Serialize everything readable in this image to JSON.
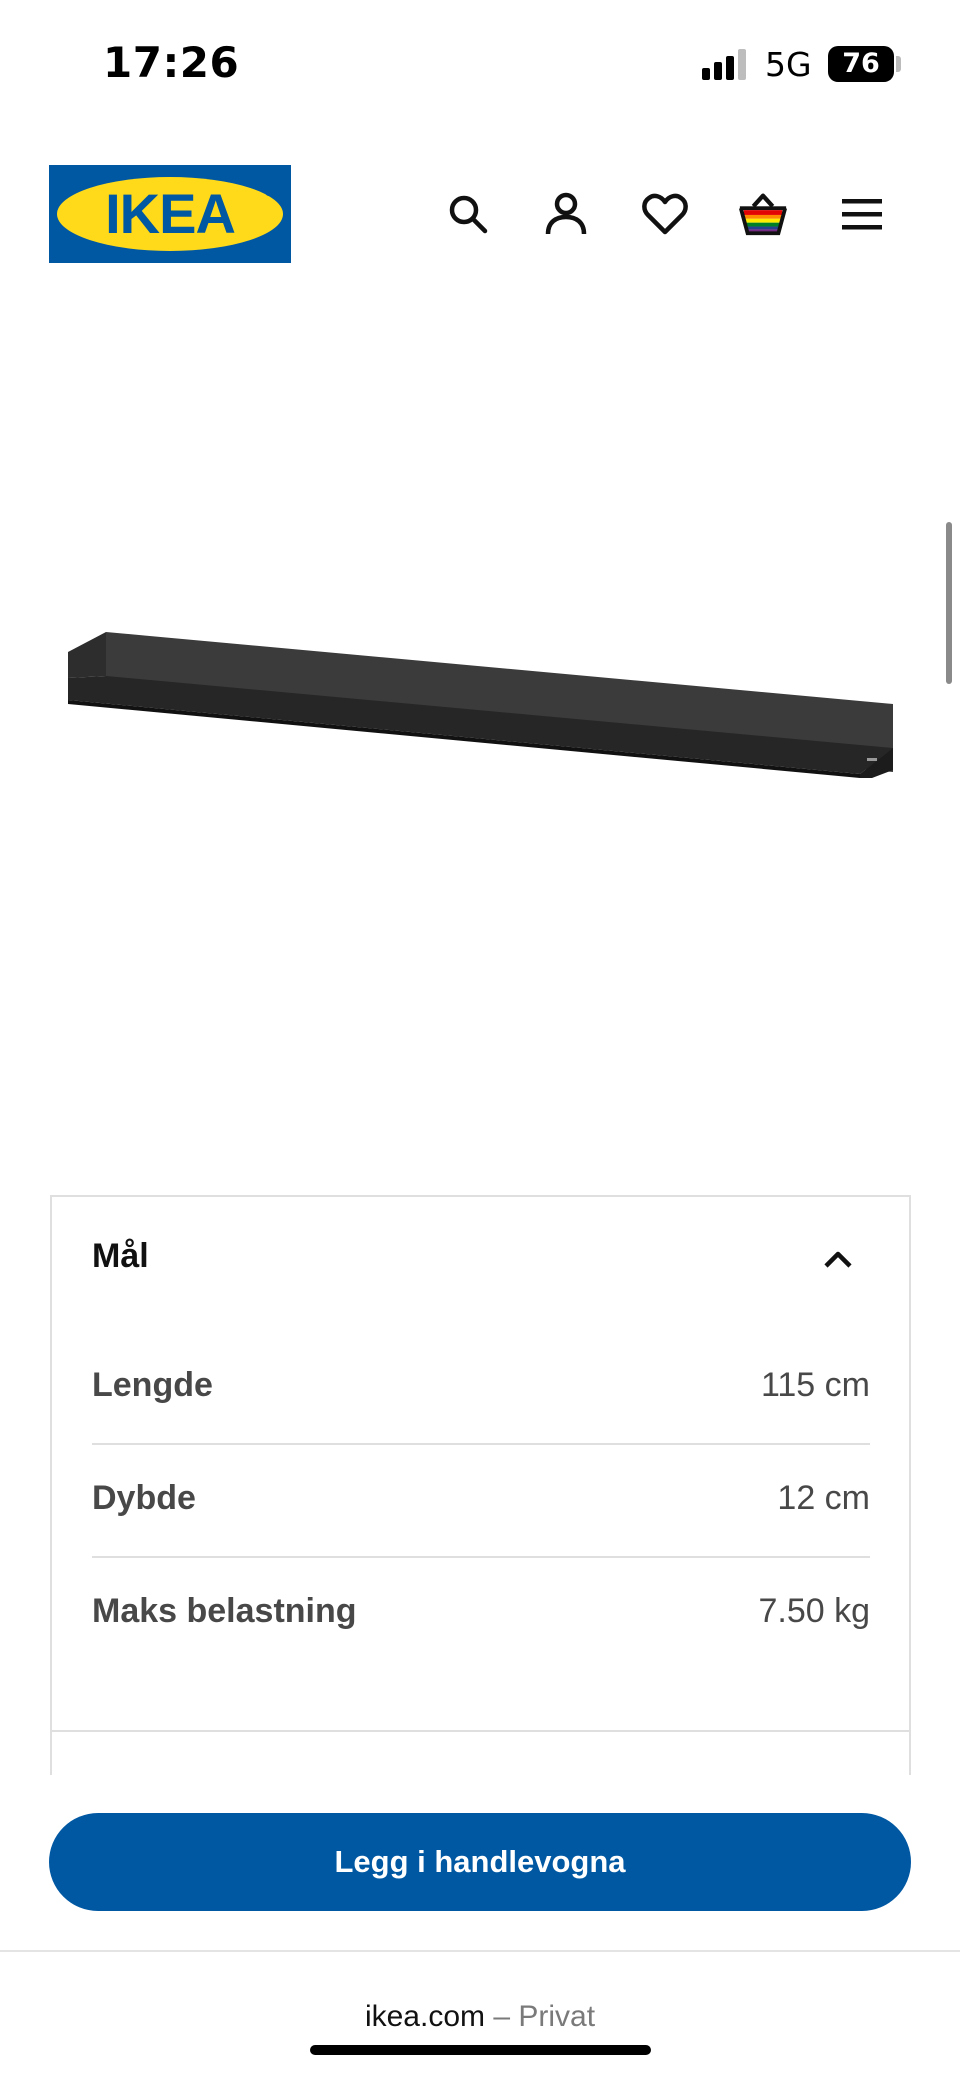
{
  "status_bar": {
    "time": "17:26",
    "network": "5G",
    "battery": "76"
  },
  "header": {
    "logo_text": "IKEA",
    "logo_colors": {
      "background": "#0058a3",
      "oval": "#ffda1a"
    },
    "icons": [
      "search-icon",
      "account-icon",
      "heart-icon",
      "basket-icon",
      "menu-icon"
    ]
  },
  "dimensions": {
    "title": "Mål",
    "rows": [
      {
        "label": "Lengde",
        "value": "115 cm"
      },
      {
        "label": "Dybde",
        "value": "12 cm"
      },
      {
        "label": "Maks belastning",
        "value": "7.50 kg"
      }
    ]
  },
  "cart": {
    "button_label": "Legg i handlevogna",
    "color": "#0058a3"
  },
  "browser": {
    "domain": "ikea.com",
    "separator": " – ",
    "mode": "Privat"
  }
}
